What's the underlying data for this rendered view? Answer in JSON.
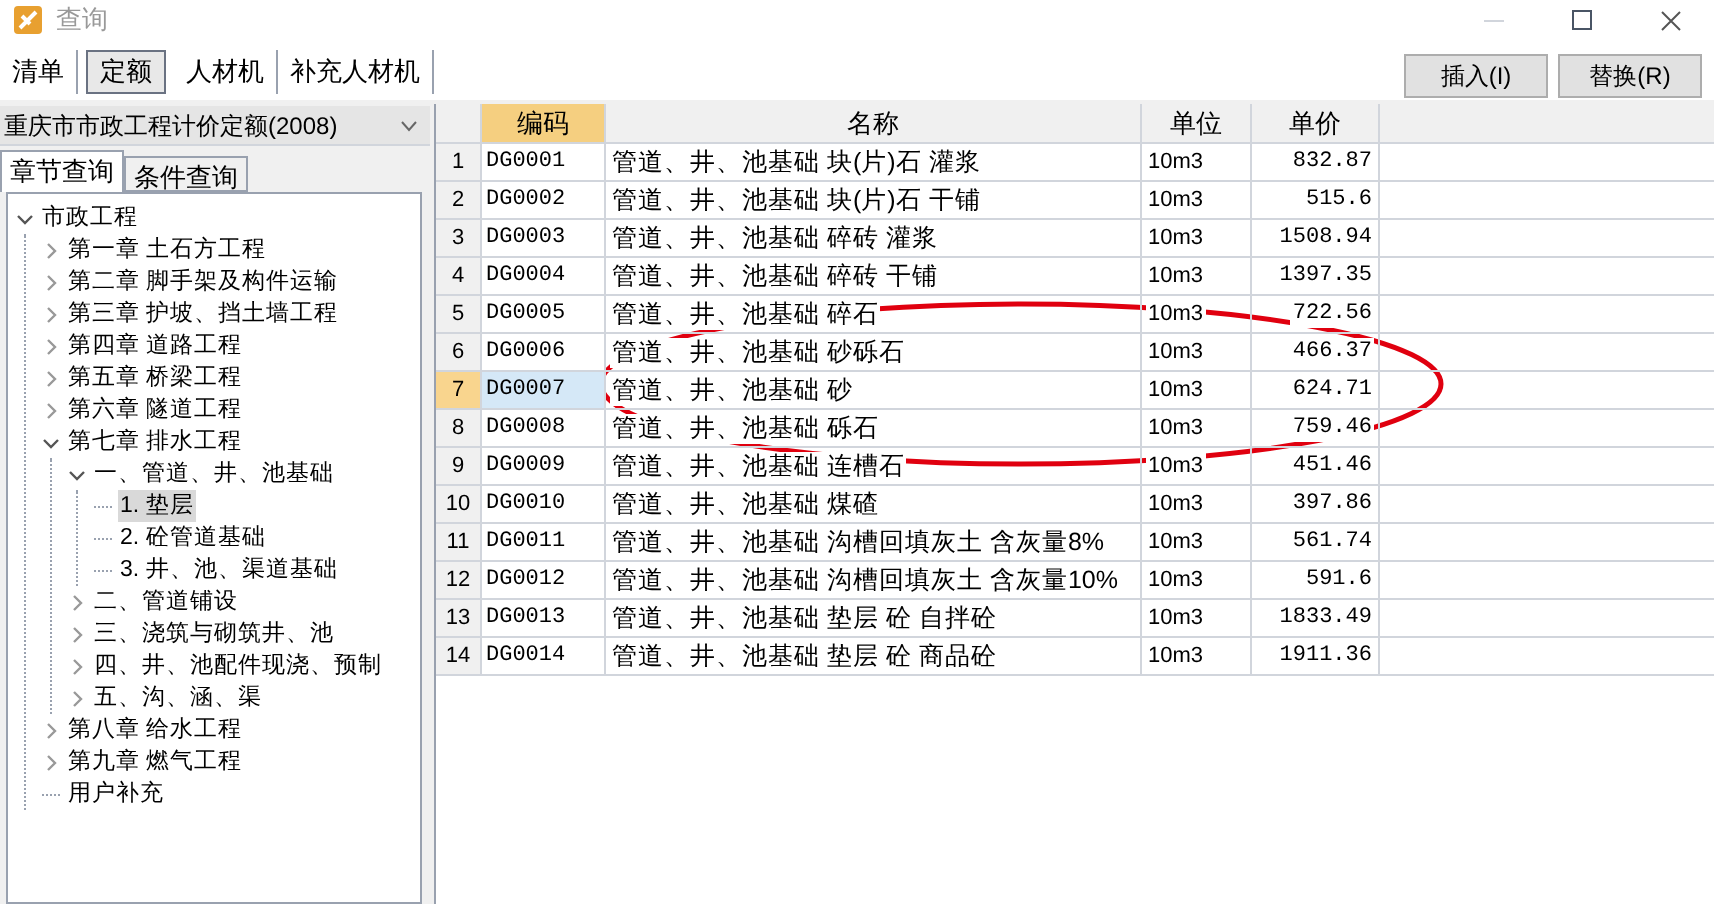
{
  "window": {
    "title": "查询"
  },
  "tabs": [
    {
      "label": "清单",
      "selected": false
    },
    {
      "label": "定额",
      "selected": true
    },
    {
      "label": "人材机",
      "selected": false
    },
    {
      "label": "补充人材机",
      "selected": false
    }
  ],
  "actions": [
    "插入(I)",
    "替换(R)"
  ],
  "library": {
    "value": "重庆市市政工程计价定额(2008)"
  },
  "subtabs": [
    {
      "label": "章节查询",
      "selected": true
    },
    {
      "label": "条件查询",
      "selected": false
    }
  ],
  "tree": [
    {
      "label": "市政工程",
      "kind": "folder",
      "expanded": true,
      "selected": false,
      "children": [
        {
          "label": "第一章  土石方工程",
          "kind": "folder",
          "expanded": false,
          "selected": false
        },
        {
          "label": "第二章  脚手架及构件运输",
          "kind": "folder",
          "expanded": false,
          "selected": false
        },
        {
          "label": "第三章  护坡、挡土墙工程",
          "kind": "folder",
          "expanded": false,
          "selected": false
        },
        {
          "label": "第四章  道路工程",
          "kind": "folder",
          "expanded": false,
          "selected": false
        },
        {
          "label": "第五章  桥梁工程",
          "kind": "folder",
          "expanded": false,
          "selected": false
        },
        {
          "label": "第六章  隧道工程",
          "kind": "folder",
          "expanded": false,
          "selected": false
        },
        {
          "label": "第七章  排水工程",
          "kind": "folder",
          "expanded": true,
          "selected": false,
          "children": [
            {
              "label": "一、管道、井、池基础",
              "kind": "folder",
              "expanded": true,
              "selected": false,
              "children": [
                {
                  "label": "1. 垫层",
                  "kind": "leaf",
                  "selected": true
                },
                {
                  "label": "2. 砼管道基础",
                  "kind": "leaf",
                  "selected": false
                },
                {
                  "label": "3. 井、池、渠道基础",
                  "kind": "leaf",
                  "selected": false
                }
              ]
            },
            {
              "label": "二、管道铺设",
              "kind": "folder",
              "expanded": false,
              "selected": false
            },
            {
              "label": "三、浇筑与砌筑井、池",
              "kind": "folder",
              "expanded": false,
              "selected": false
            },
            {
              "label": "四、井、池配件现浇、预制",
              "kind": "folder",
              "expanded": false,
              "selected": false
            },
            {
              "label": "五、沟、涵、渠",
              "kind": "folder",
              "expanded": false,
              "selected": false
            }
          ]
        },
        {
          "label": "第八章  给水工程",
          "kind": "folder",
          "expanded": false,
          "selected": false
        },
        {
          "label": "第九章  燃气工程",
          "kind": "folder",
          "expanded": false,
          "selected": false
        },
        {
          "label": "用户补充",
          "kind": "leaf",
          "selected": false
        }
      ]
    }
  ],
  "table": {
    "columns": [
      "编码",
      "名称",
      "单位",
      "单价"
    ],
    "rows": [
      {
        "index": "1",
        "code": "DG0001",
        "name": "管道、井、池基础 块(片)石 灌浆",
        "unit": "10m3",
        "price": "832.87",
        "selected": false
      },
      {
        "index": "2",
        "code": "DG0002",
        "name": "管道、井、池基础 块(片)石 干铺",
        "unit": "10m3",
        "price": "515.6",
        "selected": false
      },
      {
        "index": "3",
        "code": "DG0003",
        "name": "管道、井、池基础 碎砖 灌浆",
        "unit": "10m3",
        "price": "1508.94",
        "selected": false
      },
      {
        "index": "4",
        "code": "DG0004",
        "name": "管道、井、池基础 碎砖 干铺",
        "unit": "10m3",
        "price": "1397.35",
        "selected": false
      },
      {
        "index": "5",
        "code": "DG0005",
        "name": "管道、井、池基础 碎石",
        "unit": "10m3",
        "price": "722.56",
        "selected": false
      },
      {
        "index": "6",
        "code": "DG0006",
        "name": "管道、井、池基础 砂砾石",
        "unit": "10m3",
        "price": "466.37",
        "selected": false
      },
      {
        "index": "7",
        "code": "DG0007",
        "name": "管道、井、池基础 砂",
        "unit": "10m3",
        "price": "624.71",
        "selected": true
      },
      {
        "index": "8",
        "code": "DG0008",
        "name": "管道、井、池基础 砾石",
        "unit": "10m3",
        "price": "759.46",
        "selected": false
      },
      {
        "index": "9",
        "code": "DG0009",
        "name": "管道、井、池基础 连槽石",
        "unit": "10m3",
        "price": "451.46",
        "selected": false
      },
      {
        "index": "10",
        "code": "DG0010",
        "name": "管道、井、池基础 煤碴",
        "unit": "10m3",
        "price": "397.86",
        "selected": false
      },
      {
        "index": "11",
        "code": "DG0011",
        "name": "管道、井、池基础 沟槽回填灰土 含灰量8%",
        "unit": "10m3",
        "price": "561.74",
        "selected": false
      },
      {
        "index": "12",
        "code": "DG0012",
        "name": "管道、井、池基础 沟槽回填灰土 含灰量10%",
        "unit": "10m3",
        "price": "591.6",
        "selected": false
      },
      {
        "index": "13",
        "code": "DG0013",
        "name": "管道、井、池基础 垫层 砼 自拌砼",
        "unit": "10m3",
        "price": "1833.49",
        "selected": false
      },
      {
        "index": "14",
        "code": "DG0014",
        "name": "管道、井、池基础 垫层 砼 商品砼",
        "unit": "10m3",
        "price": "1911.36",
        "selected": false
      }
    ]
  }
}
